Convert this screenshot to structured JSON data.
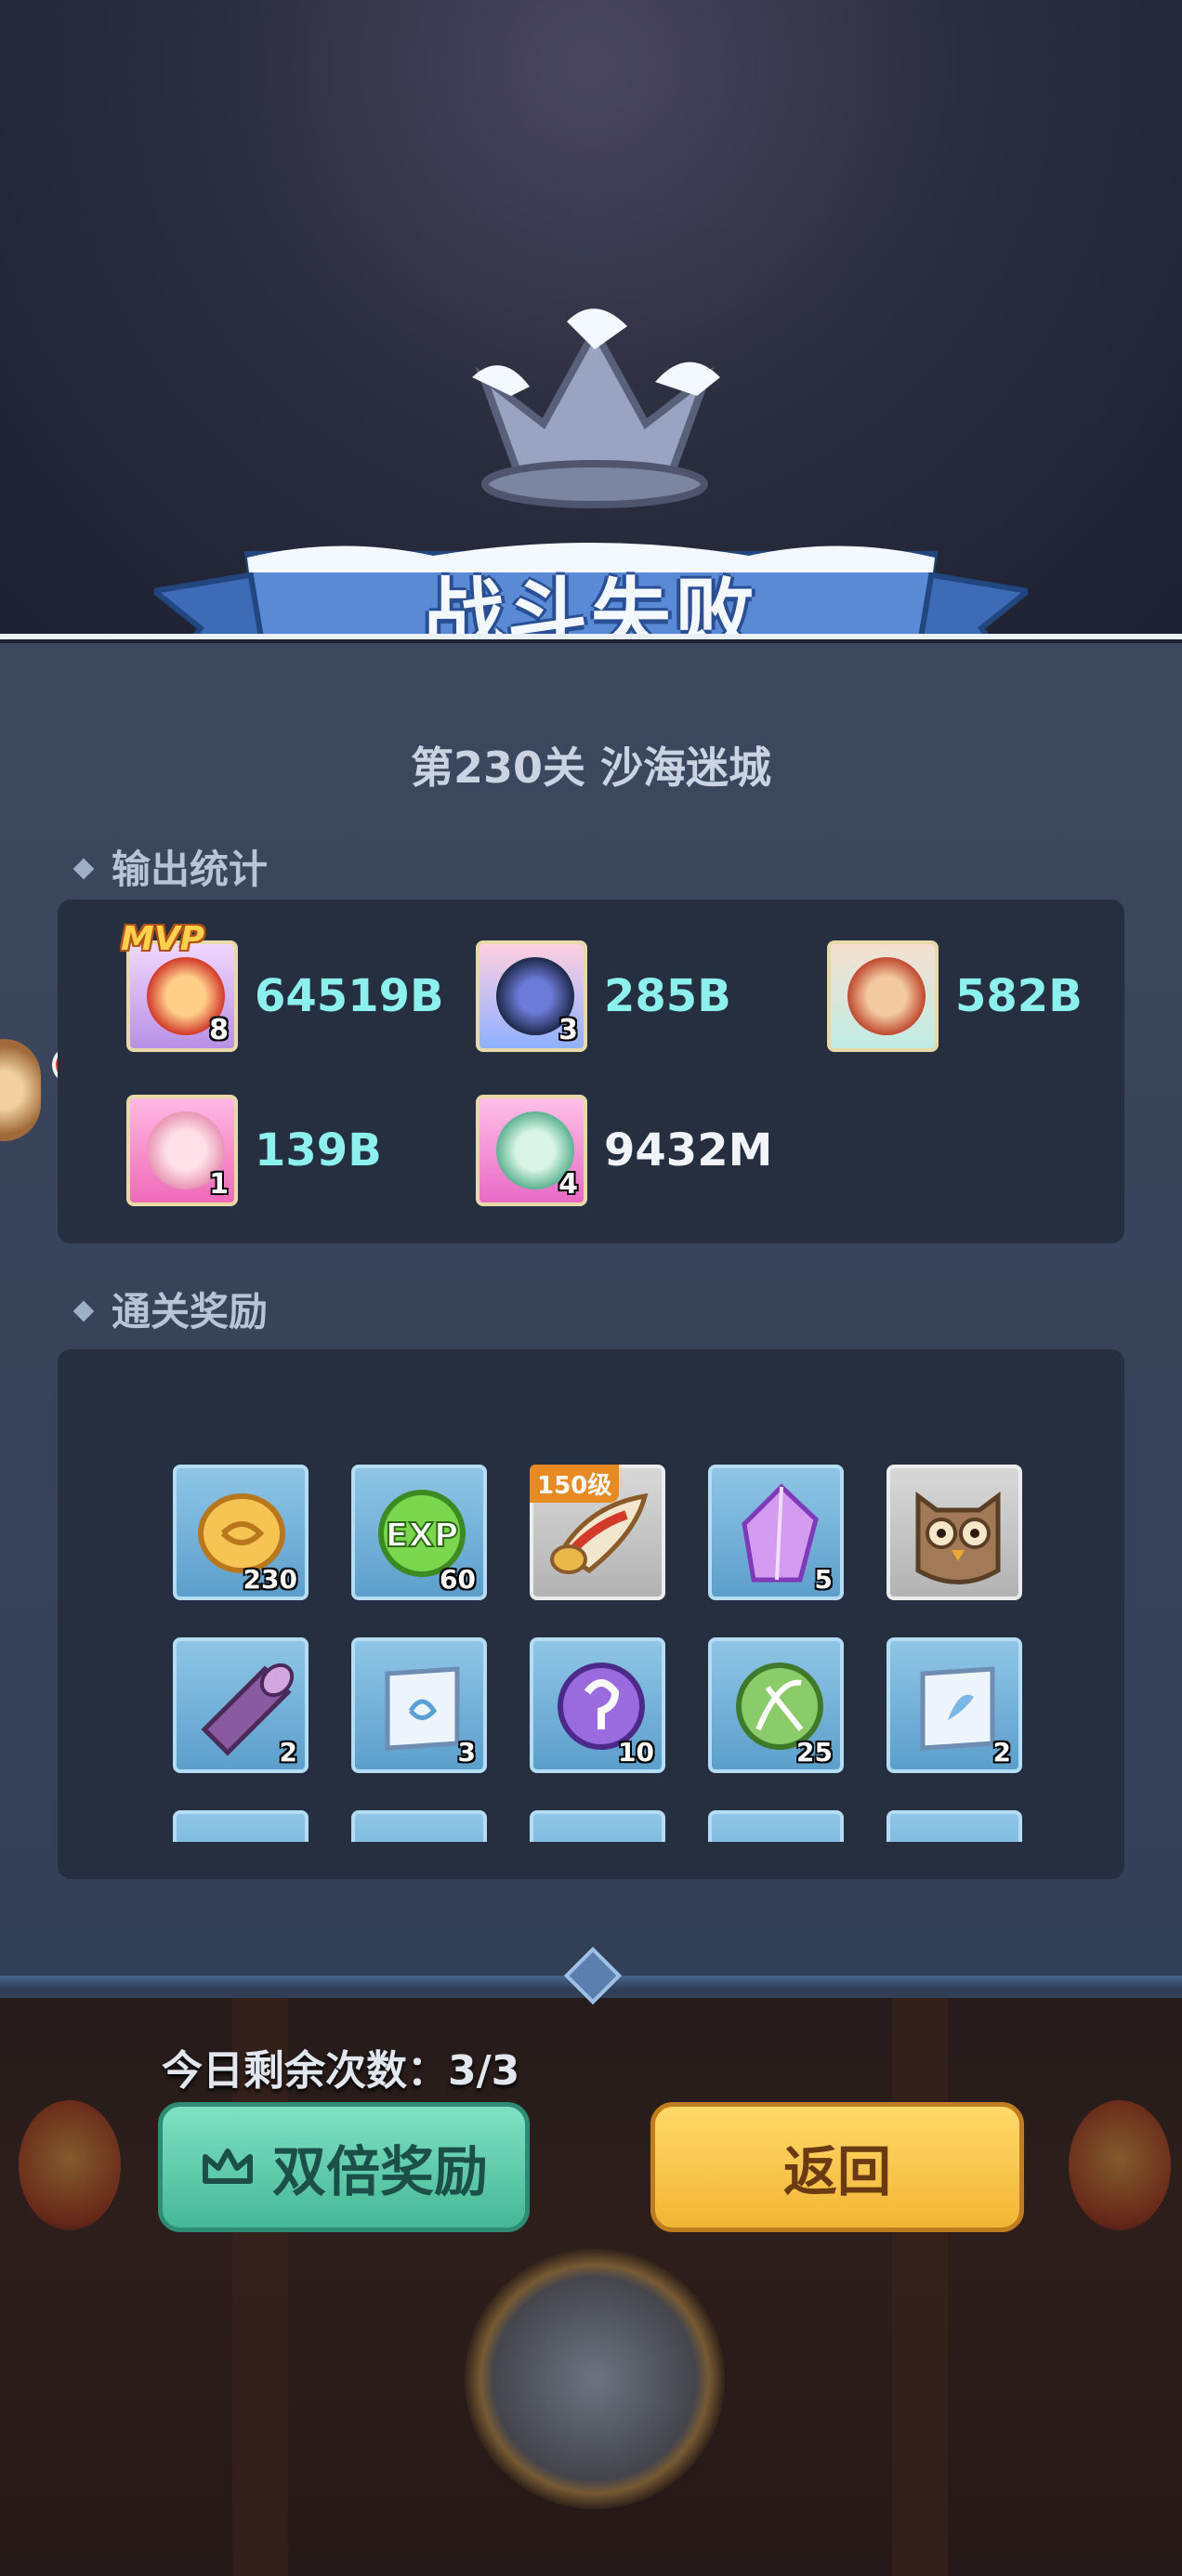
{
  "title": "战斗失败",
  "stage": "第230关 沙海迷城",
  "sections": {
    "damage": "输出统计",
    "rewards": "通关奖励"
  },
  "heroes": [
    {
      "level": "8",
      "damage": "64519B",
      "mvp": "MVP",
      "frame": "#f0d7ff"
    },
    {
      "level": "3",
      "damage": "285B",
      "frame": "#ffd0e0"
    },
    {
      "level": "",
      "damage": "582B",
      "frame": "#d0f6f2"
    },
    {
      "level": "1",
      "damage": "139B",
      "frame": "#ff9ed6"
    },
    {
      "level": "4",
      "damage": "9432M",
      "frame": "#ffb0e0"
    }
  ],
  "rewards": [
    {
      "icon": "gold-coin-icon",
      "count": "230"
    },
    {
      "icon": "exp-orb-icon",
      "count": "60"
    },
    {
      "icon": "horn-icon",
      "count": "",
      "tag": "150级"
    },
    {
      "icon": "purple-crystal-icon",
      "count": "5"
    },
    {
      "icon": "owl-icon",
      "count": ""
    },
    {
      "icon": "wood-log-icon",
      "count": "2"
    },
    {
      "icon": "scroll-icon",
      "count": "3"
    },
    {
      "icon": "purple-rune-icon",
      "count": "10"
    },
    {
      "icon": "green-rune-icon",
      "count": "25"
    },
    {
      "icon": "scroll-icon",
      "count": "2"
    }
  ],
  "remaining": "今日剩余次数：3/3",
  "buttons": {
    "double": "双倍奖励",
    "back": "返回"
  }
}
